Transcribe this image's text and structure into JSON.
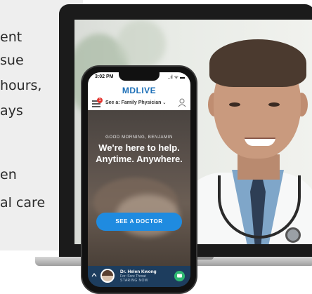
{
  "slide_text": {
    "lines": [
      "ent",
      "sue",
      "hours,",
      "ays",
      "en",
      "al care"
    ]
  },
  "phone": {
    "status_time": "3:02 PM",
    "status_icons": "..ıl ᯤ ▬",
    "brand": "MDLIVE",
    "notification_count": "1",
    "see_select": "See a: Family Physician",
    "greeting": "GOOD MORNING, BENJAMIN",
    "headline_line1": "We're here to help.",
    "headline_line2": "Anytime. Anywhere.",
    "cta_label": "SEE A DOCTOR",
    "provider_name": "Dr. Helen Kwong",
    "provider_reason": "For: Sore Throat",
    "provider_status": "STARING NOW"
  },
  "colors": {
    "brand_blue": "#1c6fb7",
    "cta_blue": "#1f8be0",
    "call_bar": "#1d3d5e",
    "chat_green": "#2fb872"
  },
  "icons": [
    "menu-icon",
    "profile-icon",
    "chevron-down-icon",
    "chevron-up-icon",
    "chat-icon"
  ]
}
